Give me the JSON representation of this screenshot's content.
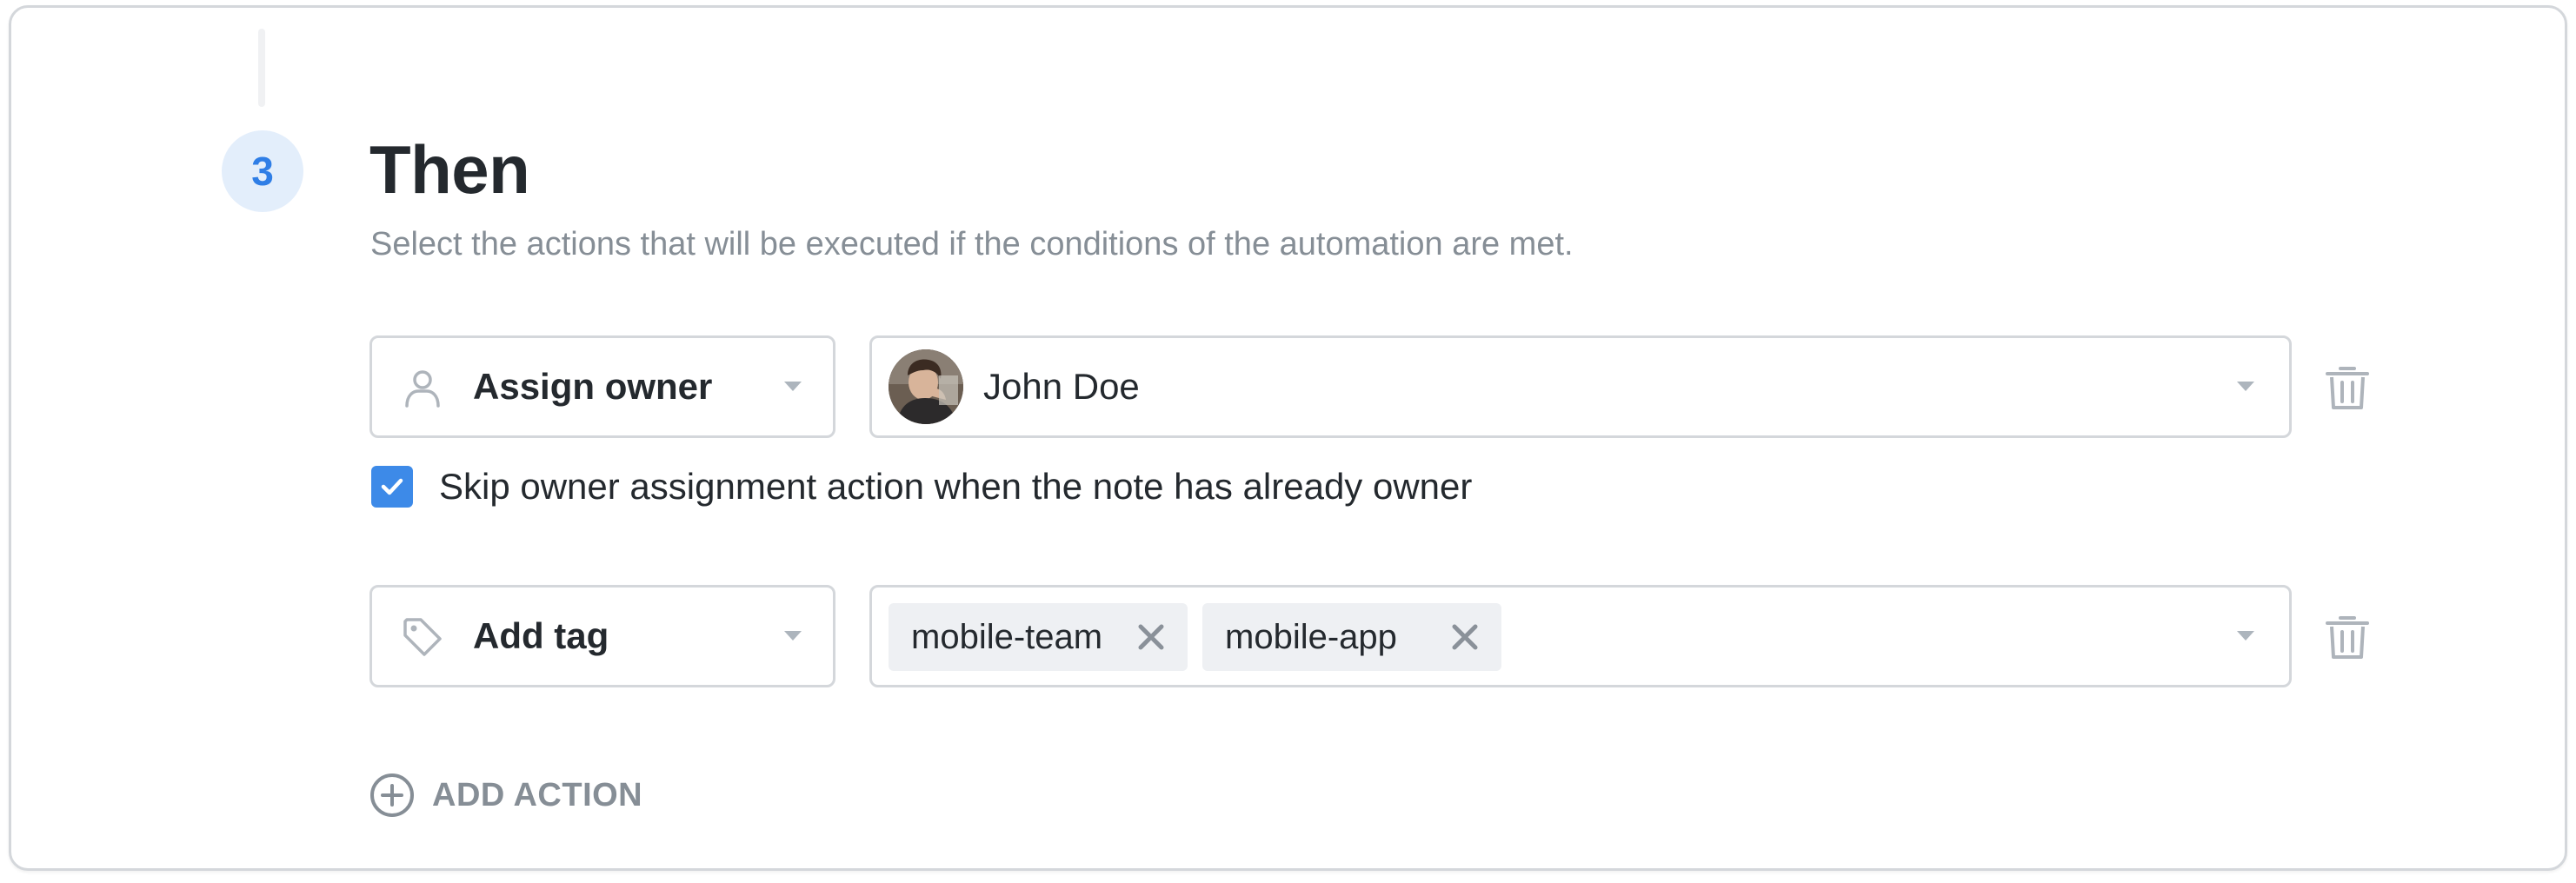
{
  "step": {
    "number": "3",
    "title": "Then",
    "subtitle": "Select the actions that will be executed if the conditions of the automation are met."
  },
  "actions": [
    {
      "action_label": "Assign owner",
      "action_icon": "user-icon",
      "value": {
        "owner_name": "John Doe",
        "avatar": "avatar"
      },
      "option": {
        "checked": true,
        "label": "Skip owner assignment action when the note has already owner"
      }
    },
    {
      "action_label": "Add tag",
      "action_icon": "tag-icon",
      "tags": [
        "mobile-team",
        "mobile-app"
      ]
    }
  ],
  "add_action_label": "ADD ACTION",
  "colors": {
    "accent": "#3d8ae8",
    "badge_bg": "#e3eefb",
    "badge_text": "#2f7ee6",
    "border": "#d4d7db",
    "muted": "#868e96",
    "text": "#24292e",
    "tag_bg": "#eef0f3"
  }
}
